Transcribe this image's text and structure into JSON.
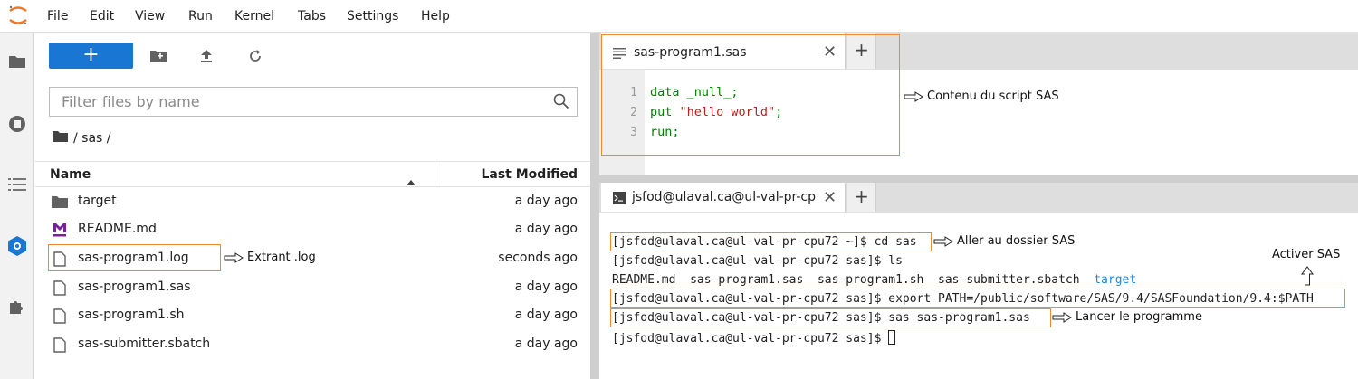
{
  "menu": {
    "items": [
      "File",
      "Edit",
      "View",
      "Run",
      "Kernel",
      "Tabs",
      "Settings",
      "Help"
    ]
  },
  "toolbar": {
    "new_label": "+"
  },
  "filter": {
    "placeholder": "Filter files by name"
  },
  "breadcrumb": {
    "path": "/ sas /"
  },
  "listing": {
    "col_name": "Name",
    "col_modified": "Last Modified",
    "files": [
      {
        "name": "target",
        "modified": "a day ago",
        "icon": "folder-icon"
      },
      {
        "name": "README.md",
        "modified": "a day ago",
        "icon": "markdown-icon"
      },
      {
        "name": "sas-program1.log",
        "modified": "seconds ago",
        "icon": "file-icon"
      },
      {
        "name": "sas-program1.sas",
        "modified": "a day ago",
        "icon": "file-icon"
      },
      {
        "name": "sas-program1.sh",
        "modified": "a day ago",
        "icon": "file-icon"
      },
      {
        "name": "sas-submitter.sbatch",
        "modified": "a day ago",
        "icon": "file-icon"
      }
    ]
  },
  "editor": {
    "tab_label": "sas-program1.sas",
    "lines": [
      {
        "num": "1",
        "text": "data _null_;"
      },
      {
        "num": "2",
        "kw": "put ",
        "str": "\"hello world\"",
        "end": ";"
      },
      {
        "num": "3",
        "text": "run;"
      }
    ]
  },
  "terminal": {
    "tab_label": "jsfod@ulaval.ca@ul-val-pr-cpu72",
    "lines": [
      "[jsfod@ulaval.ca@ul-val-pr-cpu72 ~]$ cd sas",
      "[jsfod@ulaval.ca@ul-val-pr-cpu72 sas]$ ls",
      "README.md  sas-program1.sas  sas-program1.sh  sas-submitter.sbatch  ",
      "[jsfod@ulaval.ca@ul-val-pr-cpu72 sas]$ export PATH=/public/software/SAS/9.4/SASFoundation/9.4:$PATH",
      "[jsfod@ulaval.ca@ul-val-pr-cpu72 sas]$ sas sas-program1.sas",
      "[jsfod@ulaval.ca@ul-val-pr-cpu72 sas]$ "
    ],
    "ls_dir": "target"
  },
  "annotations": {
    "script": "Contenu du script SAS",
    "log": "Extrant .log",
    "cd": "Aller au dossier SAS",
    "activate": "Activer SAS",
    "launch": "Lancer le programme"
  },
  "colors": {
    "accent": "#1976d2",
    "annotation": "#f28a2c"
  }
}
